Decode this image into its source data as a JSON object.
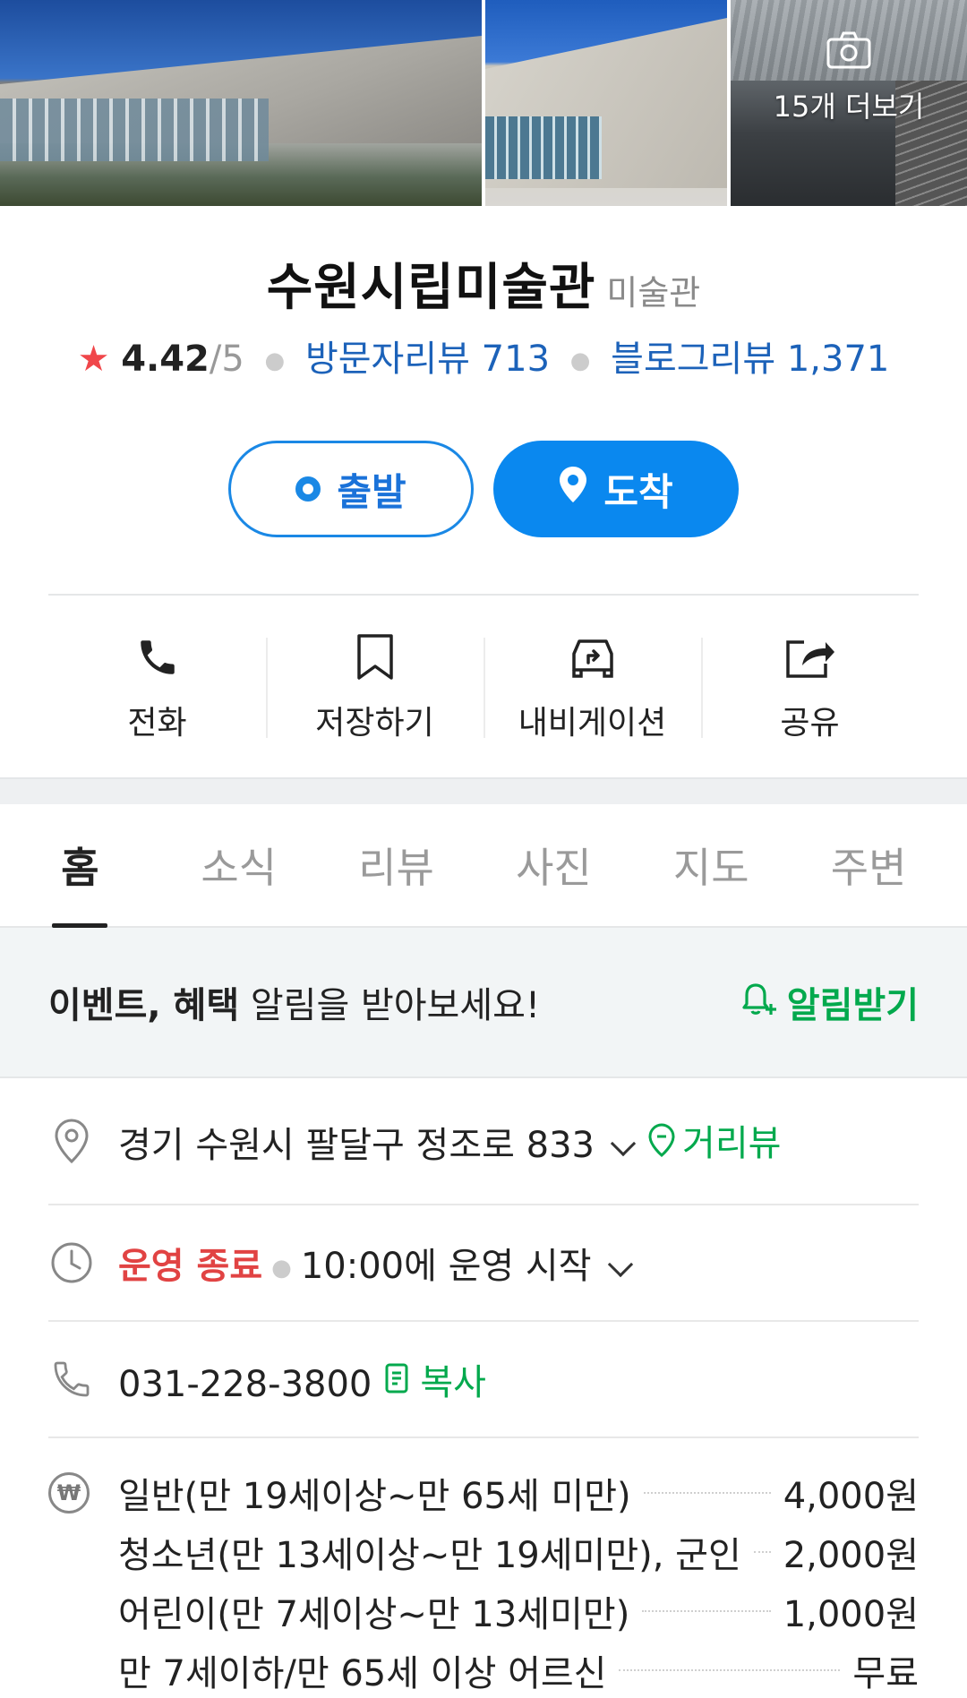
{
  "gallery": {
    "more_label": "15개 더보기"
  },
  "place": {
    "name": "수원시립미술관",
    "category": "미술관",
    "rating_score": "4.42",
    "rating_max": "/5",
    "visitor_reviews": "방문자리뷰 713",
    "blog_reviews": "블로그리뷰 1,371"
  },
  "route": {
    "depart_label": "출발",
    "arrive_label": "도착"
  },
  "actions": [
    {
      "label": "전화",
      "icon": "phone-icon"
    },
    {
      "label": "저장하기",
      "icon": "bookmark-icon"
    },
    {
      "label": "내비게이션",
      "icon": "car-navigation-icon"
    },
    {
      "label": "공유",
      "icon": "share-icon"
    }
  ],
  "tabs": [
    "홈",
    "소식",
    "리뷰",
    "사진",
    "지도",
    "주변"
  ],
  "alert": {
    "bold": "이벤트, 혜택",
    "text": " 알림을 받아보세요!",
    "cta": "알림받기"
  },
  "info": {
    "address": "경기 수원시 팔달구 정조로 833",
    "street_view": "거리뷰",
    "status": "운영 종료",
    "hours": "10:00에 운영 시작",
    "phone": "031-228-3800",
    "copy": "복사"
  },
  "fees": [
    {
      "name": "일반(만 19세이상~만 65세 미만)",
      "price": "4,000원"
    },
    {
      "name": "청소년(만 13세이상~만 19세미만), 군인",
      "price": "2,000원"
    },
    {
      "name": "어린이(만 7세이상~만 13세미만)",
      "price": "1,000원"
    },
    {
      "name": "만 7세이하/만 65세 이상 어르신",
      "price": "무료"
    }
  ],
  "colors": {
    "accent_blue": "#0a88ef",
    "link_blue": "#1c62b9",
    "green": "#03a94d",
    "closed_red": "#e14343",
    "star": "#f0464a"
  }
}
